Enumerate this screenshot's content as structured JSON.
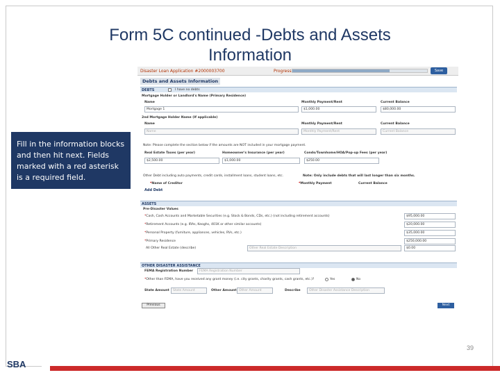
{
  "slide": {
    "title_line1": "Form 5C continued -Debts and Assets",
    "title_line2": "Information",
    "callout": "Fill in the information blocks and then hit next.  Fields marked with a red asterisk is a required field.",
    "page_number": "39",
    "logo_text": "SBA"
  },
  "app": {
    "title": "Disaster Loan Application #2000003700",
    "progress_label": "Progress:",
    "progress_fraction": 0.72,
    "save_label": "Save",
    "heading": "Debts and Assets Information"
  },
  "debts": {
    "band": "DEBTS",
    "no_debts_label": "I have no debts",
    "mortgage_holder_label": "Mortgage Holder or Landlord's Name (Primary Residence)",
    "name_label": "Name",
    "monthly_label": "Monthly Payment/Rent",
    "balance_label": "Current Balance",
    "mortgage_name": "Mortgage 1",
    "mortgage_monthly": "$1,000.00",
    "mortgage_balance": "$80,000.00",
    "second_holder_label": "2nd Mortgage Holder Name (If applicable)",
    "second_name_ph": "Name",
    "second_monthly_ph": "Monthly Payment/Rent",
    "second_balance_ph": "Current Balance",
    "note": "Note: Please complete the section below if the amounts are NOT included in your mortgage payment.",
    "real_estate_label": "Real Estate Taxes (per year)",
    "homeowners_label": "Homeowner's Insurance (per year)",
    "condo_label": "Condo/Townhome/HOA/Pop-up Fees (per year)",
    "real_estate_value": "$2,500.00",
    "homeowners_value": "$1,000.00",
    "condo_value": "$250.00",
    "other_debt_note": "Other Debt including auto payments, credit cards, installment loans, student loans, etc.",
    "other_debt_note2": "Note: Only include debts that will last longer than six months.",
    "creditor_label": "Name of Creditor",
    "monthly_payment_label": "Monthly Payment",
    "current_balance_label": "Current Balance",
    "add_debt": "Add Debt"
  },
  "assets": {
    "band": "ASSETS",
    "predisaster": "Pre-Disaster Values",
    "rows": [
      {
        "label": "Cash, Cash Accounts and Marketable Securities (e.g. Stock & Bonds, CDs, etc.) (not including retirement accounts)",
        "value": "$95,000.00"
      },
      {
        "label": "Retirement Accounts (e.g. IRAs, Keoghs, 401K or other similar accounts)",
        "value": "$20,000.00"
      },
      {
        "label": "Personal Property (furniture, appliances, vehicles, RVs, etc.)",
        "value": "$35,000.00"
      },
      {
        "label": "Primary Residence",
        "value": "$250,000.00"
      }
    ],
    "other_re_label": "All Other Real Estate (describe)",
    "other_re_ph": "Other Real Estate Description",
    "other_re_value": "$0.00"
  },
  "other_assistance": {
    "band": "OTHER DISASTER ASSISTANCE",
    "fema_label": "FEMA Registration Number",
    "fema_ph": "FEMA Registration Number",
    "question": "Other than FEMA, have you received any grant money (i.e. city grants, charity grants, cash grants, etc.)?",
    "yes": "Yes",
    "no": "No",
    "state_label": "State Amount",
    "state_ph": "State Amount",
    "other_label": "Other Amount",
    "other_ph": "Other Amount",
    "describe_label": "Describe",
    "describe_ph": "Other Disaster Assistance Description"
  },
  "nav": {
    "previous": "Previous",
    "next": "Next"
  },
  "colors": {
    "title": "#1f3864",
    "callout_bg": "#1f3864",
    "footer_bar": "#cc2a2a",
    "required": "#c00000"
  }
}
